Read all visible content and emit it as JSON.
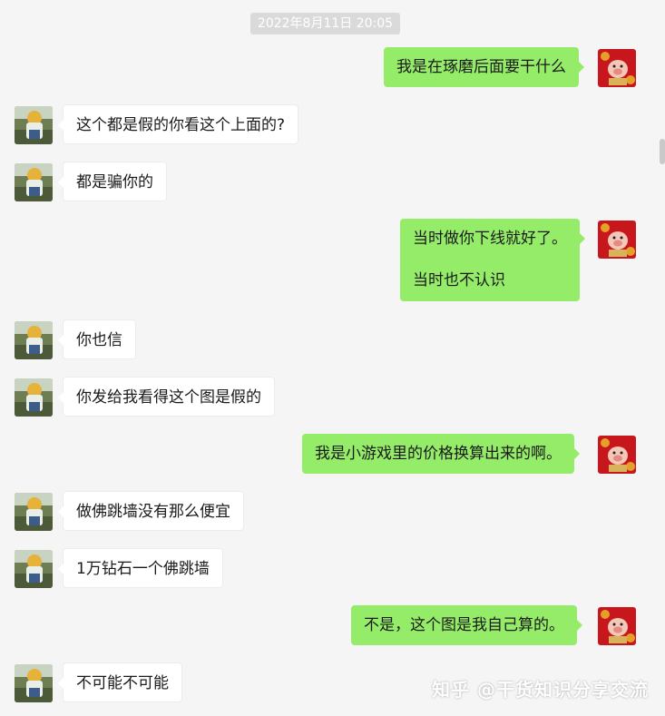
{
  "timestamp": "2022年8月11日 20:05",
  "messages": [
    {
      "side": "right",
      "text": "我是在琢磨后面要干什么"
    },
    {
      "side": "left",
      "text": "这个都是假的你看这个上面的?"
    },
    {
      "side": "left",
      "text": "都是骗你的"
    },
    {
      "side": "right",
      "lines": [
        "当时做你下线就好了。",
        "当时也不认识"
      ]
    },
    {
      "side": "left",
      "text": "你也信"
    },
    {
      "side": "left",
      "text": "你发给我看得这个图是假的"
    },
    {
      "side": "right",
      "text": "我是小游戏里的价格换算出来的啊。"
    },
    {
      "side": "left",
      "text": "做佛跳墙没有那么便宜"
    },
    {
      "side": "left",
      "text": "1万钻石一个佛跳墙"
    },
    {
      "side": "right",
      "text": "不是，这个图是我自己算的。"
    },
    {
      "side": "left",
      "text": "不可能不可能"
    }
  ],
  "watermark": "知乎 @干货知识分享交流",
  "colors": {
    "background": "#f5f5f5",
    "self_bubble": "#95ec69",
    "other_bubble": "#ffffff"
  }
}
